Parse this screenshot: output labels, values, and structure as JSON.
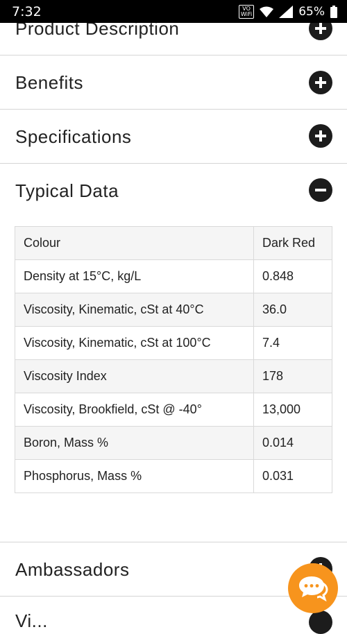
{
  "status_bar": {
    "time": "7:32",
    "volte_top": "VO",
    "volte_bottom": "WiFi",
    "battery_pct": "65%"
  },
  "accordion": {
    "product_description": "Product Description",
    "benefits": "Benefits",
    "specifications": "Specifications",
    "typical_data": "Typical Data",
    "ambassadors": "Ambassadors",
    "next_partial": "Vi..."
  },
  "typical_data_table": [
    {
      "property": "Colour",
      "value": "Dark Red"
    },
    {
      "property": "Density at 15°C, kg/L",
      "value": "0.848"
    },
    {
      "property": "Viscosity, Kinematic, cSt at 40°C",
      "value": "36.0"
    },
    {
      "property": "Viscosity, Kinematic, cSt at 100°C",
      "value": "7.4"
    },
    {
      "property": "Viscosity Index",
      "value": "178"
    },
    {
      "property": "Viscosity, Brookfield, cSt @ -40°",
      "value": "13,000"
    },
    {
      "property": "Boron, Mass %",
      "value": "0.014"
    },
    {
      "property": "Phosphorus, Mass %",
      "value": "0.031"
    }
  ],
  "icons": {
    "expand": "plus-circle-icon",
    "collapse": "minus-circle-icon",
    "chat": "chat-bubbles-icon"
  },
  "colors": {
    "accent": "#f7941d",
    "icon_bg": "#1c1c1c"
  }
}
